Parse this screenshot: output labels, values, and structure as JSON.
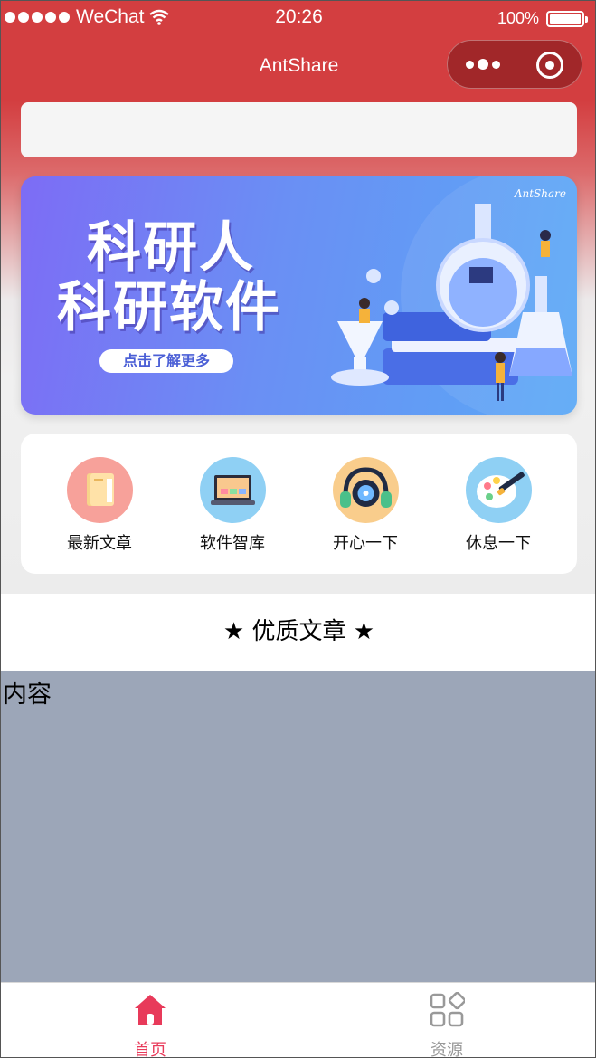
{
  "status_bar": {
    "carrier": "WeChat",
    "time": "20:26",
    "battery": "100%",
    "signal_dots": 5
  },
  "navbar": {
    "title": "AntShare",
    "capsule": {
      "more_icon": "more-dots-icon",
      "close_icon": "target-circle-icon"
    }
  },
  "search": {
    "placeholder": "",
    "value": ""
  },
  "banner": {
    "line1": "科研人",
    "line2": "科研软件",
    "button": "点击了解更多",
    "brand": "AntShare"
  },
  "quick_nav": [
    {
      "label": "最新文章",
      "icon": "book-icon",
      "color": "#f7a19a"
    },
    {
      "label": "软件智库",
      "icon": "laptop-icon",
      "color": "#8fd0f4"
    },
    {
      "label": "开心一下",
      "icon": "headphones-icon",
      "color": "#f9cd8c"
    },
    {
      "label": "休息一下",
      "icon": "palette-icon",
      "color": "#8fd0f4"
    }
  ],
  "section": {
    "title": "★ 优质文章 ★"
  },
  "content": {
    "text": "内容"
  },
  "tabbar": {
    "items": [
      {
        "label": "首页",
        "icon": "home-icon",
        "active": true,
        "color": "#e83a5a"
      },
      {
        "label": "资源",
        "icon": "grid-icon",
        "active": false,
        "color": "#999999"
      }
    ]
  },
  "colors": {
    "header_red": "#d33e40",
    "banner_start": "#7d6cf5",
    "banner_end": "#5aa8f6",
    "content_bg": "#9ca6b8"
  }
}
